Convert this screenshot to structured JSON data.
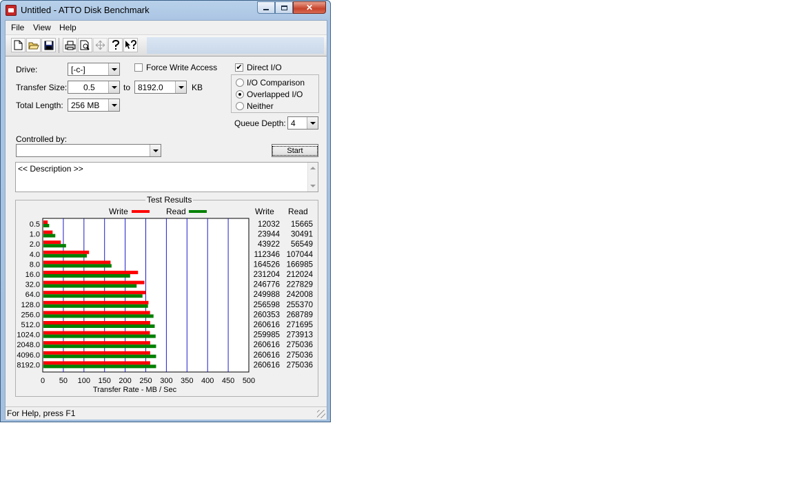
{
  "window": {
    "title": "Untitled - ATTO Disk Benchmark",
    "close_glyph": "✕"
  },
  "menu": {
    "items": [
      "File",
      "View",
      "Help"
    ]
  },
  "toolbar": {
    "buttons": [
      "new-icon",
      "open-icon",
      "save-icon",
      "print-icon",
      "print-preview-icon",
      "move-icon",
      "help-icon",
      "context-help-icon"
    ]
  },
  "form": {
    "drive_label": "Drive:",
    "drive_value": "[-c-]",
    "force_write_label": "Force Write Access",
    "force_write_checked": false,
    "direct_io_label": "Direct I/O",
    "direct_io_checked": true,
    "transfer_size_label": "Transfer Size:",
    "transfer_from": "0.5",
    "to_label": "to",
    "transfer_to": "8192.0",
    "kb_label": "KB",
    "total_length_label": "Total Length:",
    "total_length_value": "256 MB",
    "radio_options": [
      "I/O Comparison",
      "Overlapped I/O",
      "Neither"
    ],
    "radio_selected": 1,
    "queue_depth_label": "Queue Depth:",
    "queue_depth_value": "4",
    "controlled_by_label": "Controlled by:",
    "controlled_by_value": "",
    "start_label": "Start",
    "description": "<< Description >>"
  },
  "results": {
    "title": "Test Results",
    "write_legend": "Write",
    "read_legend": "Read",
    "write_col": "Write",
    "read_col": "Read",
    "write_color": "#ff0000",
    "read_color": "#008000"
  },
  "chart_data": {
    "type": "bar",
    "orientation": "horizontal",
    "categories": [
      "0.5",
      "1.0",
      "2.0",
      "4.0",
      "8.0",
      "16.0",
      "32.0",
      "64.0",
      "128.0",
      "256.0",
      "512.0",
      "1024.0",
      "2048.0",
      "4096.0",
      "8192.0"
    ],
    "series": [
      {
        "name": "Write",
        "values": [
          12032,
          23944,
          43922,
          112346,
          164526,
          231204,
          246776,
          249988,
          256598,
          260353,
          260616,
          259985,
          260616,
          260616,
          260616
        ]
      },
      {
        "name": "Read",
        "values": [
          15665,
          30491,
          56549,
          107044,
          166985,
          212024,
          227829,
          242008,
          255370,
          268789,
          271695,
          273913,
          275036,
          275036,
          275036
        ]
      }
    ],
    "xlabel": "Transfer Rate - MB / Sec",
    "xticks": [
      "0",
      "50",
      "100",
      "150",
      "200",
      "250",
      "300",
      "350",
      "400",
      "450",
      "500"
    ],
    "xlim": [
      0,
      500
    ],
    "grid": true
  },
  "status": {
    "text": "For Help, press F1"
  }
}
